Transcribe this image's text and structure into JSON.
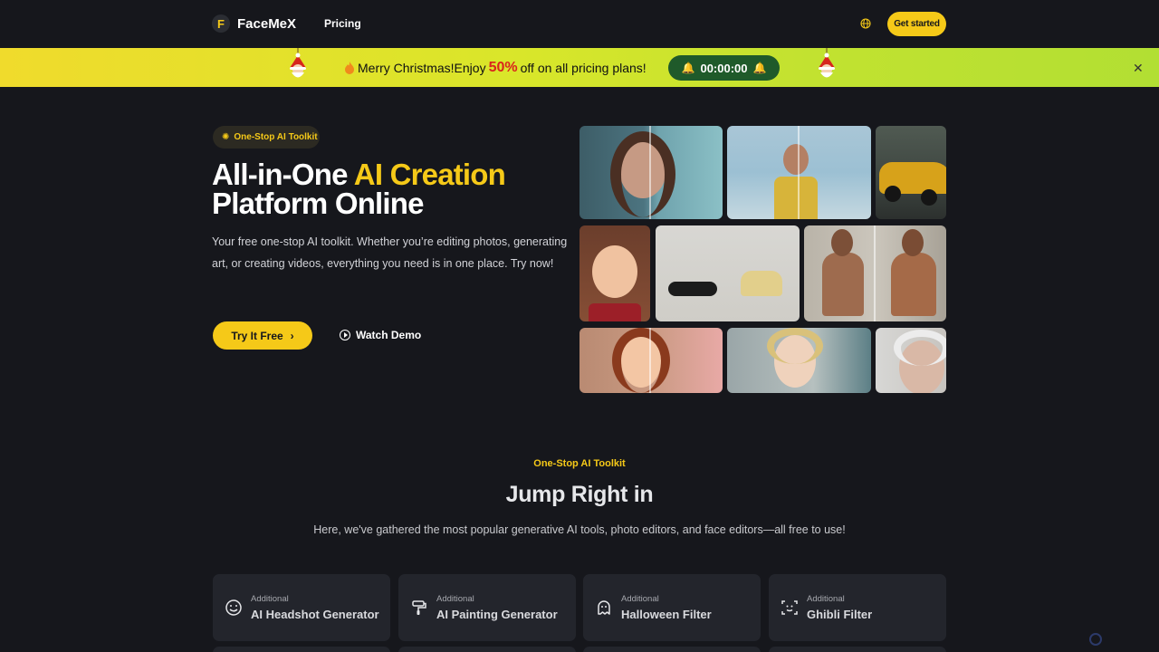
{
  "nav": {
    "logo_text": "FaceMeX",
    "logo_mark": "F",
    "pricing_link": "Pricing",
    "globe_icon": "globe-icon",
    "cta": "Get started"
  },
  "promo": {
    "text_before": "Merry Christmas!Enjoy ",
    "percent": "50%",
    "text_after": " off on all pricing plans!",
    "timer": "00:00:00",
    "close": "✕",
    "colors": {
      "banner_start": "#f0db2c",
      "banner_end": "#b2df33",
      "timer_bg": "#1f5a2a",
      "percent": "#d9241c"
    }
  },
  "hero": {
    "badge": "One-Stop AI Toolkit",
    "title_line1_plain": "All-in-One ",
    "title_line1_accent": "AI Creation",
    "title_line2": "Platform Online",
    "description": "Your free one-stop AI toolkit. Whether you’re editing photos, generating art, or creating videos, everything you need is in one place. Try now!",
    "try_button": "Try It Free",
    "demo_button": "Watch Demo"
  },
  "section": {
    "kicker": "One-Stop AI Toolkit",
    "title": "Jump Right in",
    "description": "Here, we've gathered the most popular generative AI tools, photo editors, and face editors—all free to use!"
  },
  "cards": [
    {
      "kicker": "Additional",
      "title": "AI Headshot Generator",
      "icon": "smile-face-icon"
    },
    {
      "kicker": "Additional",
      "title": "AI Painting Generator",
      "icon": "paint-roller-icon"
    },
    {
      "kicker": "Additional",
      "title": "Halloween Filter",
      "icon": "ghost-icon"
    },
    {
      "kicker": "Additional",
      "title": "Ghibli Filter",
      "icon": "face-scan-icon"
    }
  ],
  "colors": {
    "background": "#16171c",
    "accent": "#f5c918",
    "card": "#23252c"
  }
}
